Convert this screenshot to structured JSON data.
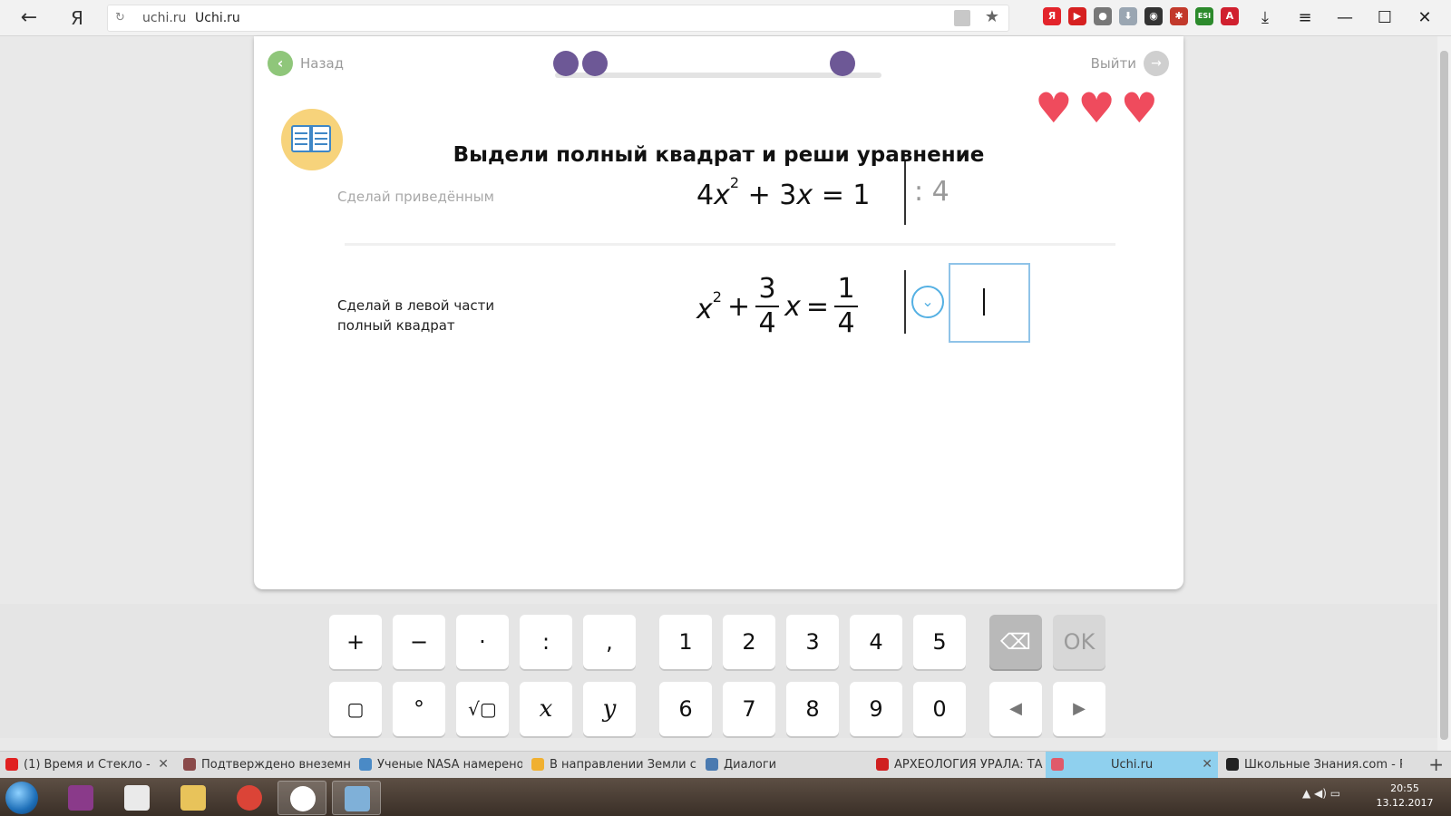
{
  "browser": {
    "back_glyph": "←",
    "ya_glyph": "Я",
    "reload_glyph": "↻",
    "domain": "uchi.ru",
    "page_title": "Uchi.ru",
    "star_glyph": "★",
    "extensions": [
      {
        "icon": "yandex-icon",
        "glyph": "Я",
        "color": "#e3242b"
      },
      {
        "icon": "youtube-icon",
        "glyph": "▶",
        "color": "#d62020"
      },
      {
        "icon": "bulb-icon",
        "glyph": "●",
        "color": "#777777"
      },
      {
        "icon": "download-arrow-icon",
        "glyph": "⬇",
        "color": "#9aa6b2"
      },
      {
        "icon": "location-icon",
        "glyph": "◉",
        "color": "#333333"
      },
      {
        "icon": "bug-icon",
        "glyph": "✱",
        "color": "#c2392b"
      },
      {
        "icon": "esi-icon",
        "glyph": "ESI",
        "color": "#2c8a2c"
      },
      {
        "icon": "adobe-icon",
        "glyph": "A",
        "color": "#d0202f"
      }
    ],
    "window_controls": [
      "⤓",
      "≡",
      "—",
      "☐",
      "✕"
    ]
  },
  "header": {
    "back_label": "Назад",
    "back_glyph": "‹",
    "exit_label": "Выйти",
    "exit_glyph": "→"
  },
  "progress": {
    "dots": [
      1,
      2,
      3
    ],
    "colors": {
      "dot": "#6d5896",
      "track": "#e3e3e3"
    }
  },
  "task": {
    "title": "Выдели полный квадрат и реши уравнение",
    "lives": [
      "♥",
      "♥",
      "♥"
    ]
  },
  "step1": {
    "label": "Сделай приведённым",
    "coef": "4",
    "var": "x",
    "exp": "2",
    "plus": "+",
    "coef2": "3",
    "var2": "x",
    "equals": "=",
    "rhs": "1",
    "divisor": ": 4"
  },
  "step2": {
    "label": "Сделай в левой части полный квадрат",
    "var": "x",
    "exp": "2",
    "plus": "+",
    "frac1_num": "3",
    "frac1_den": "4",
    "var2": "x",
    "equals": "=",
    "frac2_num": "1",
    "frac2_den": "4",
    "dropdown_glyph": "⌄"
  },
  "keypad": {
    "row1_ops": [
      "+",
      "−",
      "·",
      ":",
      ","
    ],
    "row1_digits": [
      "1",
      "2",
      "3",
      "4",
      "5"
    ],
    "backspace_glyph": "⌫",
    "ok_label": "OK",
    "row2_ops": [
      "▢",
      "°",
      "√▢",
      "x",
      "y"
    ],
    "row2_digits": [
      "6",
      "7",
      "8",
      "9",
      "0"
    ],
    "left_glyph": "◀",
    "right_glyph": "▶"
  },
  "tabs": [
    {
      "title": "(1) Время и Стекло - ",
      "icon": "youtube-icon",
      "color": "#e02020",
      "close": "✕"
    },
    {
      "title": "Подтверждено внеземное",
      "icon": "rg-icon",
      "color": "#8a4a4a",
      "close": ""
    },
    {
      "title": "Ученые NASA намерено ск",
      "icon": "globe-icon",
      "color": "#4a8ac6",
      "close": ""
    },
    {
      "title": "В направлении Земли с ко",
      "icon": "a-icon",
      "color": "#f0b030",
      "close": ""
    },
    {
      "title": "Диалоги",
      "icon": "chat-icon",
      "color": "#4a7ab0",
      "close": ""
    },
    {
      "title": "АРХЕОЛОГИЯ УРАЛА: ТАЙ",
      "icon": "z-icon",
      "color": "#d02020",
      "close": ""
    },
    {
      "title": "Uchi.ru",
      "icon": "uchi-icon",
      "color": "#e05a6a",
      "close": "✕"
    },
    {
      "title": "Школьные Знания.com - Р",
      "icon": "znania-icon",
      "color": "#222222",
      "close": ""
    }
  ],
  "new_tab_glyph": "+",
  "taskbar": {
    "tray": "▲  ◀)  ▭",
    "time": "20:55",
    "date": "13.12.2017"
  }
}
